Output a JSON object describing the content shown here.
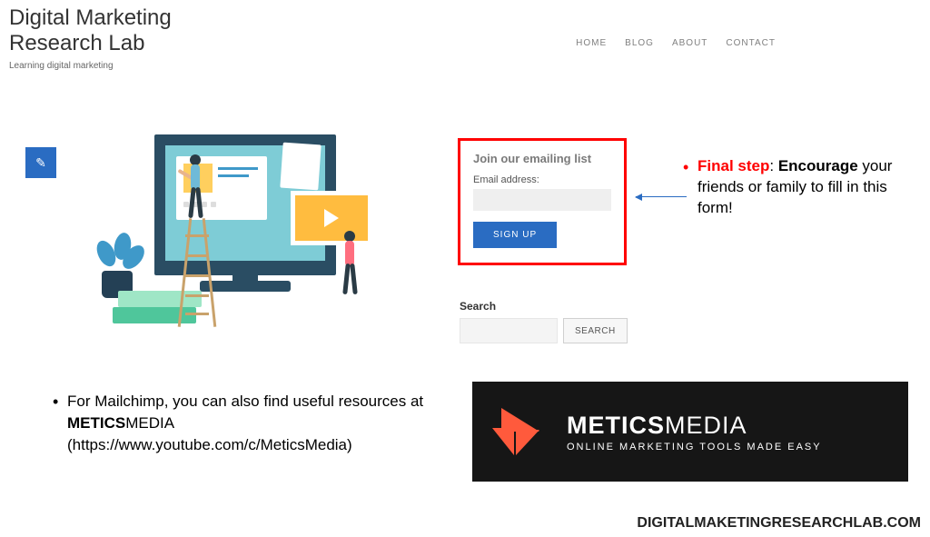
{
  "header": {
    "title": "Digital Marketing Research Lab",
    "tagline": "Learning digital marketing",
    "nav": {
      "home": "HOME",
      "blog": "BLOG",
      "about": "ABOUT",
      "contact": "CONTACT"
    }
  },
  "edit_button": {
    "icon": "✎"
  },
  "form": {
    "title": "Join our emailing list",
    "email_label": "Email address:",
    "signup_label": "SIGN UP"
  },
  "annotation": {
    "final_step": "Final step",
    "colon": ": ",
    "encourage": "Encourage",
    "rest": " your friends or family to fill in this form!"
  },
  "search": {
    "label": "Search",
    "button": "SEARCH"
  },
  "lower_note": {
    "line1": "For Mailchimp, you can also find useful resources at ",
    "brand_bold": "METICS",
    "brand_rest": "MEDIA",
    "line2": " (https://www.youtube.com/c/MeticsMedia)"
  },
  "mm_banner": {
    "title_bold": "METICS",
    "title_light": "MEDIA",
    "subtitle": "ONLINE MARKETING TOOLS MADE EASY"
  },
  "watermark": "DIGITALMAKETINGRESEARCHLAB.COM"
}
